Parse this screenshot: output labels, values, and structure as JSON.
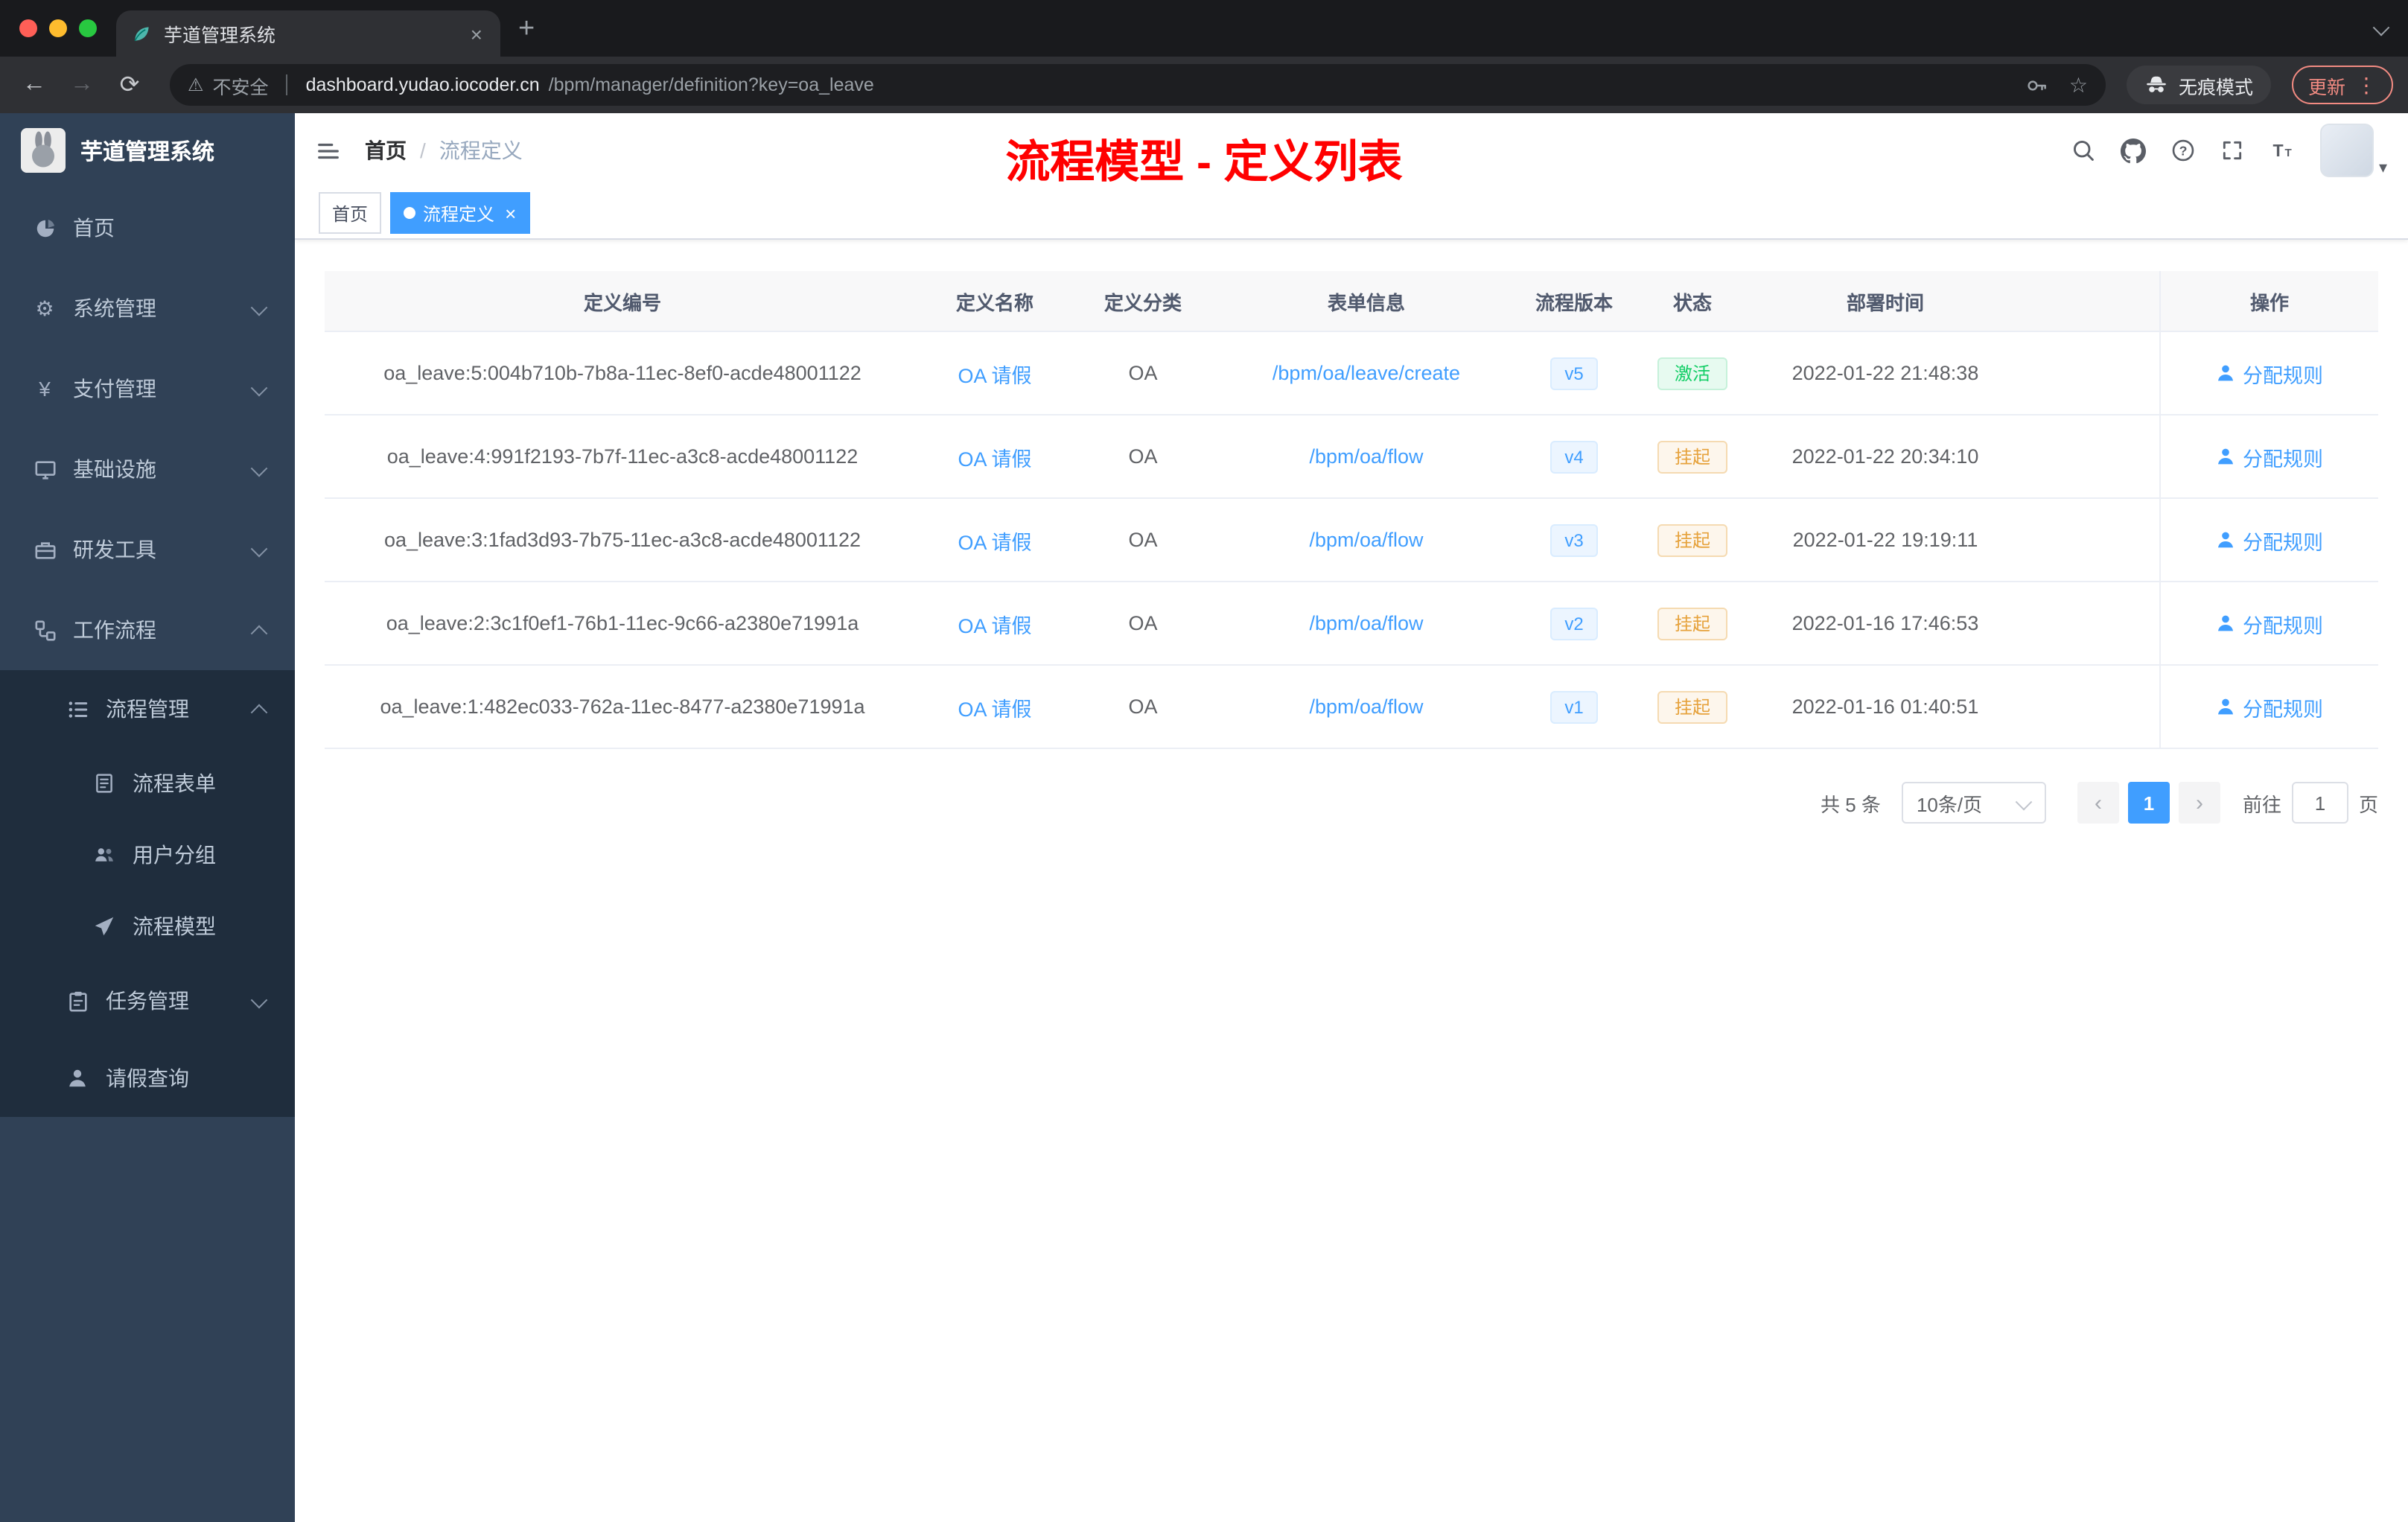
{
  "browser": {
    "tab": {
      "title": "芋道管理系统"
    },
    "address": {
      "security_label": "不安全",
      "url_host": "dashboard.yudao.iocoder.cn",
      "url_path": "/bpm/manager/definition?key=oa_leave",
      "incognito_label": "无痕模式",
      "update_label": "更新"
    }
  },
  "icons": {
    "back": "←",
    "forward": "→",
    "reload": "⟳",
    "warning": "⚠",
    "star": "☆",
    "kebab": "⋮",
    "new_tab": "+",
    "close": "×",
    "gear": "⚙",
    "yen": "¥",
    "caret_down": "▾",
    "prev": "‹",
    "next": "›"
  },
  "sidebar": {
    "logo_title": "芋道管理系统",
    "items": [
      {
        "label": "首页"
      },
      {
        "label": "系统管理"
      },
      {
        "label": "支付管理"
      },
      {
        "label": "基础设施"
      },
      {
        "label": "研发工具"
      },
      {
        "label": "工作流程"
      },
      {
        "label": "流程管理"
      },
      {
        "label": "流程表单"
      },
      {
        "label": "用户分组"
      },
      {
        "label": "流程模型"
      },
      {
        "label": "任务管理"
      },
      {
        "label": "请假查询"
      }
    ]
  },
  "navbar": {
    "breadcrumb_home": "首页",
    "breadcrumb_sep": "/",
    "breadcrumb_current": "流程定义",
    "annotation": "流程模型 - 定义列表"
  },
  "tags": {
    "home": "首页",
    "current": "流程定义"
  },
  "table": {
    "columns": [
      "定义编号",
      "定义名称",
      "定义分类",
      "表单信息",
      "流程版本",
      "状态",
      "部署时间",
      "操作"
    ],
    "action_label": "分配规则",
    "rows": [
      {
        "id": "oa_leave:5:004b710b-7b8a-11ec-8ef0-acde48001122",
        "name": "OA 请假",
        "category": "OA",
        "form": "/bpm/oa/leave/create",
        "version": "v5",
        "status": "激活",
        "status_type": "success",
        "deploy_time": "2022-01-22 21:48:38"
      },
      {
        "id": "oa_leave:4:991f2193-7b7f-11ec-a3c8-acde48001122",
        "name": "OA 请假",
        "category": "OA",
        "form": "/bpm/oa/flow",
        "version": "v4",
        "status": "挂起",
        "status_type": "warning",
        "deploy_time": "2022-01-22 20:34:10"
      },
      {
        "id": "oa_leave:3:1fad3d93-7b75-11ec-a3c8-acde48001122",
        "name": "OA 请假",
        "category": "OA",
        "form": "/bpm/oa/flow",
        "version": "v3",
        "status": "挂起",
        "status_type": "warning",
        "deploy_time": "2022-01-22 19:19:11"
      },
      {
        "id": "oa_leave:2:3c1f0ef1-76b1-11ec-9c66-a2380e71991a",
        "name": "OA 请假",
        "category": "OA",
        "form": "/bpm/oa/flow",
        "version": "v2",
        "status": "挂起",
        "status_type": "warning",
        "deploy_time": "2022-01-16 17:46:53"
      },
      {
        "id": "oa_leave:1:482ec033-762a-11ec-8477-a2380e71991a",
        "name": "OA 请假",
        "category": "OA",
        "form": "/bpm/oa/flow",
        "version": "v1",
        "status": "挂起",
        "status_type": "warning",
        "deploy_time": "2022-01-16 01:40:51"
      }
    ]
  },
  "pagination": {
    "total_label": "共 5 条",
    "page_size_label": "10条/页",
    "current_page": "1",
    "goto_label": "前往",
    "goto_value": "1",
    "unit_label": "页"
  },
  "colors": {
    "accent": "#409eff",
    "annotation_red": "#ff0000",
    "status_success": "#13ce66",
    "status_warning": "#e6a23c",
    "sidebar_bg": "#304156",
    "submenu_bg": "#1f2d3d"
  }
}
